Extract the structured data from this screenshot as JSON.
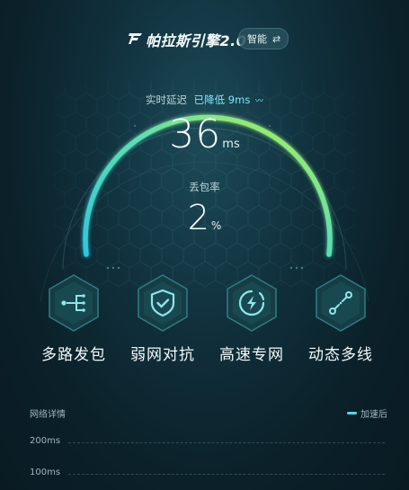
{
  "header": {
    "app_title": "帕拉斯引擎2.0",
    "mode_label": "智能",
    "mode_icon": "swap-icon"
  },
  "gauge": {
    "latency_label": "实时延迟",
    "latency_reduction": "已降低 9ms",
    "latency_value": "36",
    "latency_unit": "ms",
    "loss_label": "丢包率",
    "loss_value": "2",
    "loss_unit": "%",
    "arc_start_color": "#2fc6de",
    "arc_end_color": "#b8f04a"
  },
  "features": [
    {
      "label": "多路发包",
      "icon": "multipath-icon"
    },
    {
      "label": "弱网对抗",
      "icon": "shield-check-icon"
    },
    {
      "label": "高速专网",
      "icon": "lightning-icon"
    },
    {
      "label": "动态多线",
      "icon": "dynamic-route-icon"
    }
  ],
  "chart": {
    "title": "网络详情",
    "legend": "加速后",
    "legend_color": "#54d6e8",
    "y_ticks": [
      "200ms",
      "100ms"
    ]
  },
  "chart_data": {
    "type": "line",
    "title": "网络详情",
    "series": [
      {
        "name": "加速后",
        "values": []
      }
    ],
    "y_ticks": [
      "200ms",
      "100ms"
    ]
  }
}
